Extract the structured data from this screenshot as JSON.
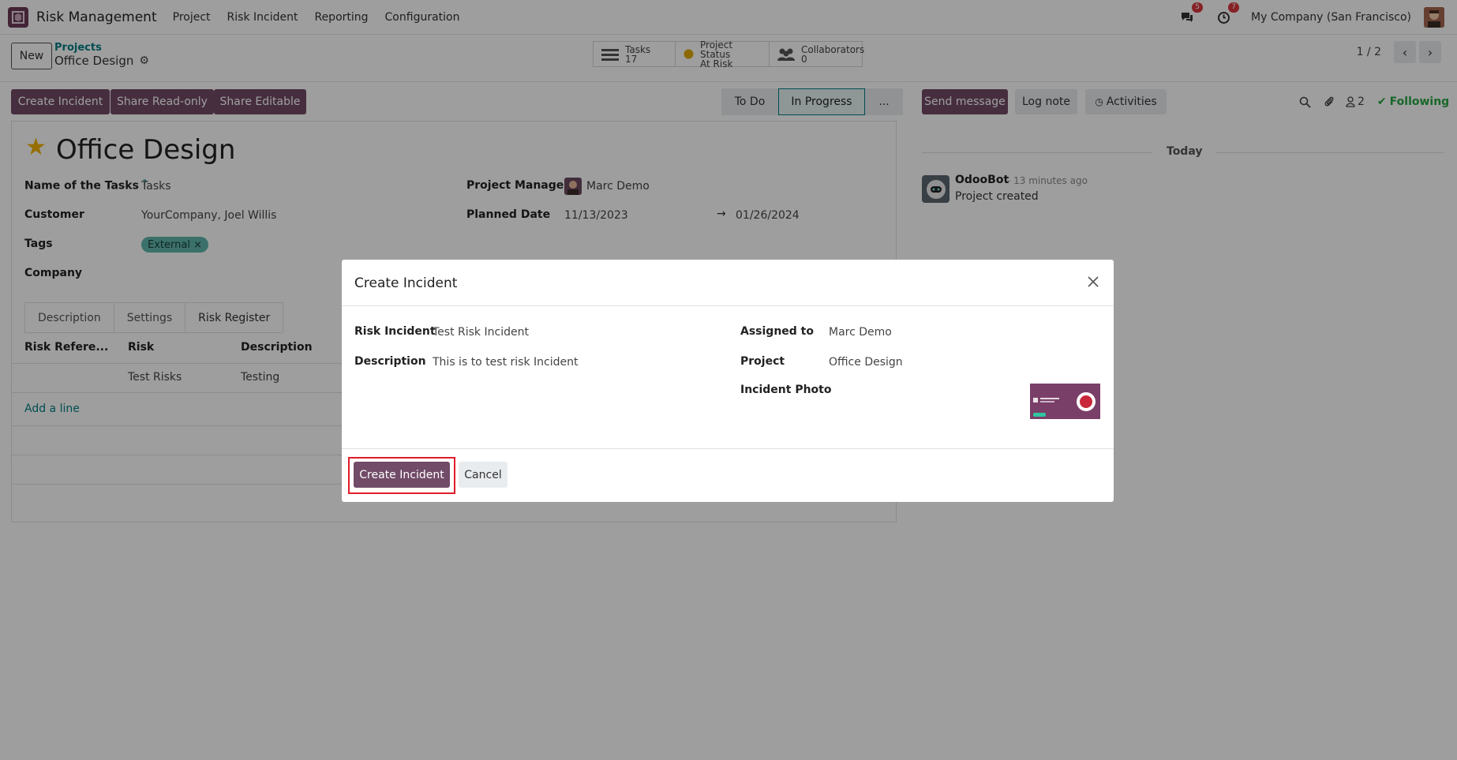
{
  "navbar": {
    "app_name": "Risk Management",
    "menu": [
      "Project",
      "Risk Incident",
      "Reporting",
      "Configuration"
    ],
    "messages_count": "5",
    "activities_count": "7",
    "company": "My Company (San Francisco)"
  },
  "control_panel": {
    "new_label": "New",
    "breadcrumb_parent": "Projects",
    "breadcrumb_current": "Office Design",
    "smart_buttons": {
      "tasks_label": "Tasks",
      "tasks_value": "17",
      "status_label": "Project Status",
      "status_value": "At Risk",
      "collab_label": "Collaborators",
      "collab_value": "0"
    },
    "pager": "1 / 2"
  },
  "form": {
    "buttons": [
      "Create Incident",
      "Share Read-only",
      "Share Editable"
    ],
    "stages": [
      "To Do",
      "In Progress",
      "..."
    ],
    "active_stage": "In Progress",
    "title": "Office Design",
    "fields": {
      "task_name_label": "Name of the Tasks",
      "task_name_help": "?",
      "task_name_value": "Tasks",
      "customer_label": "Customer",
      "customer_value": "YourCompany, Joel Willis",
      "tags_label": "Tags",
      "tag_value": "External",
      "tag_remove": "×",
      "company_label": "Company",
      "manager_label": "Project Manager",
      "manager_value": "Marc Demo",
      "planned_label": "Planned Date",
      "planned_start": "11/13/2023",
      "planned_arrow": "→",
      "planned_end": "01/26/2024"
    },
    "tabs": [
      "Description",
      "Settings",
      "Risk Register"
    ],
    "active_tab": "Risk Register",
    "table": {
      "headers": [
        "Risk Refere...",
        "Risk",
        "Description"
      ],
      "rows": [
        [
          "",
          "Test Risks",
          "Testing"
        ]
      ],
      "add_line": "Add a line"
    }
  },
  "chatter": {
    "send_message": "Send message",
    "log_note": "Log note",
    "activities": "Activities",
    "followers_count": "2",
    "following": "Following",
    "today": "Today",
    "message": {
      "author": "OdooBot",
      "time": "- 13 minutes ago",
      "body": "Project created"
    }
  },
  "modal": {
    "title": "Create Incident",
    "fields": {
      "risk_incident_label": "Risk Incident",
      "risk_incident_value": "Test Risk Incident",
      "description_label": "Description",
      "description_value": "This is to test risk Incident",
      "assigned_label": "Assigned to",
      "assigned_value": "Marc Demo",
      "project_label": "Project",
      "project_value": "Office Design",
      "photo_label": "Incident Photo"
    },
    "create_label": "Create Incident",
    "cancel_label": "Cancel"
  },
  "colors": {
    "brand": "#714b67",
    "accent": "#017e84",
    "highlight": "#e11d2a",
    "star": "#f3b300"
  }
}
